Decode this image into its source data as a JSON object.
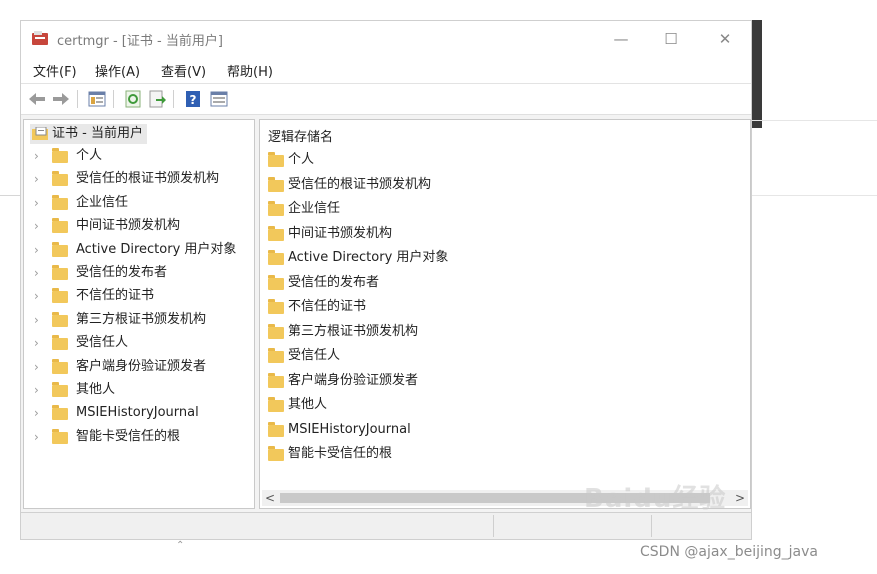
{
  "window": {
    "title": "certmgr - [证书 - 当前用户]",
    "controls": {
      "minimize": "—",
      "maximize": "☐",
      "close": "✕"
    }
  },
  "menu": [
    "文件(F)",
    "操作(A)",
    "查看(V)",
    "帮助(H)"
  ],
  "toolbar": {
    "icons": [
      "back-arrow-icon",
      "forward-arrow-icon",
      "show-console-tree-icon",
      "refresh-icon",
      "export-list-icon",
      "help-icon",
      "properties-icon"
    ]
  },
  "tree": {
    "root": "证书 - 当前用户",
    "items": [
      "个人",
      "受信任的根证书颁发机构",
      "企业信任",
      "中间证书颁发机构",
      "Active Directory 用户对象",
      "受信任的发布者",
      "不信任的证书",
      "第三方根证书颁发机构",
      "受信任人",
      "客户端身份验证颁发者",
      "其他人",
      "MSIEHistoryJournal",
      "智能卡受信任的根"
    ]
  },
  "list": {
    "header": "逻辑存储名",
    "items": [
      "个人",
      "受信任的根证书颁发机构",
      "企业信任",
      "中间证书颁发机构",
      "Active Directory 用户对象",
      "受信任的发布者",
      "不信任的证书",
      "第三方根证书颁发机构",
      "受信任人",
      "客户端身份验证颁发者",
      "其他人",
      "MSIEHistoryJournal",
      "智能卡受信任的根"
    ]
  },
  "scrollbar": {
    "left": "<",
    "right": ">"
  },
  "watermark": "Baidu经验",
  "footer": "CSDN @ajax_beijing_java",
  "colors": {
    "folder": "#f2c85b",
    "selected": "#e8e8e8"
  }
}
